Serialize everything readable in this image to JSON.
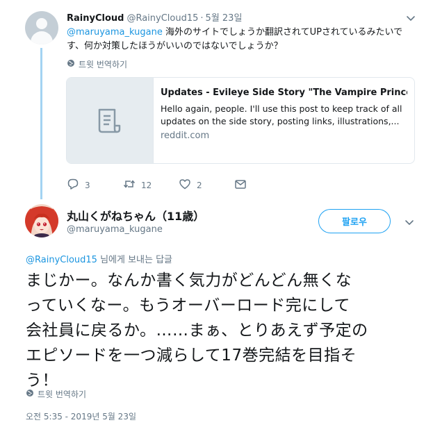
{
  "reply_tweet": {
    "display_name": "RainyCloud",
    "handle": "@RainyCloud15",
    "separator": "·",
    "date": "5월 23일",
    "mention": "@maruyama_kugane",
    "text_line1": " 海外のサイトでしょうか翻訳されてUPされているみたいで",
    "text_line2": "す、何か対策したほうがいいのではないでしょうか？",
    "translate_label": "트윗 번역하기",
    "card": {
      "title": "Updates - Evileye Side Story \"The Vampire Princes...",
      "description": "Hello again, people. I'll use this post to keep track of all updates on the side story, posting links, illustrations,...",
      "domain": "reddit.com",
      "thumb_icon": "document-icon"
    },
    "actions": {
      "replies": "3",
      "retweets": "12",
      "likes": "2"
    }
  },
  "main_tweet": {
    "display_name": "丸山くがねちゃん（11歳）",
    "handle": "@maruyama_kugane",
    "follow_label": "팔로우",
    "replying_mention": "@RainyCloud15",
    "replying_suffix": " 님에게 보내는 답글",
    "text_line1": "まじかー。なんか書く気力がどんどん無くな",
    "text_line2": "っていくなー。もうオーバーロード完にして",
    "text_line3": "会社員に戻るか。……まぁ、とりあえず予定の",
    "text_line4": "エピソードを一つ減らして17巻完結を目指そ",
    "text_line5": "う！",
    "translate_label": "트윗 번역하기",
    "timestamp": "오전 5:35 - 2019년 5월 23일"
  },
  "colors": {
    "link": "#1b95e0",
    "secondary_text": "#657786",
    "thread_line": "#a3d3f2",
    "follow_accent": "#1da1f2"
  }
}
